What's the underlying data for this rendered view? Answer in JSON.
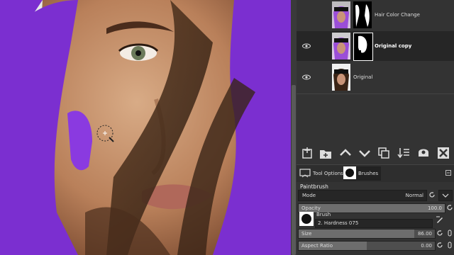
{
  "layers": [
    {
      "name": "Hair Color Change",
      "visible": false,
      "active": false
    },
    {
      "name": "Original copy",
      "visible": true,
      "active": true
    },
    {
      "name": "Original",
      "visible": true,
      "active": false
    }
  ],
  "layer_toolbar": {
    "icons": [
      "new-layer-icon",
      "new-layer-group-icon",
      "raise-layer-icon",
      "lower-layer-icon",
      "duplicate-layer-icon",
      "merge-down-icon",
      "add-mask-icon",
      "delete-layer-icon"
    ]
  },
  "tabs": {
    "tool_options": "Tool Options",
    "brushes": "Brushes"
  },
  "tool_options": {
    "tool_name": "Paintbrush",
    "mode_label": "Mode",
    "mode_value": "Normal",
    "opacity_label": "Opacity",
    "opacity_value": "100.0",
    "opacity_fraction": 1.0,
    "brush_label": "Brush",
    "brush_value": "2. Hardness 075",
    "size_label": "Size",
    "size_value": "86.00",
    "size_fraction": 0.85,
    "aspect_label": "Aspect Ratio",
    "aspect_value": "0.00",
    "aspect_fraction": 0.5
  },
  "colors": {
    "hair_purple": "#7b2fd0",
    "panel_bg": "#333333",
    "active_layer_bg": "#262626"
  }
}
